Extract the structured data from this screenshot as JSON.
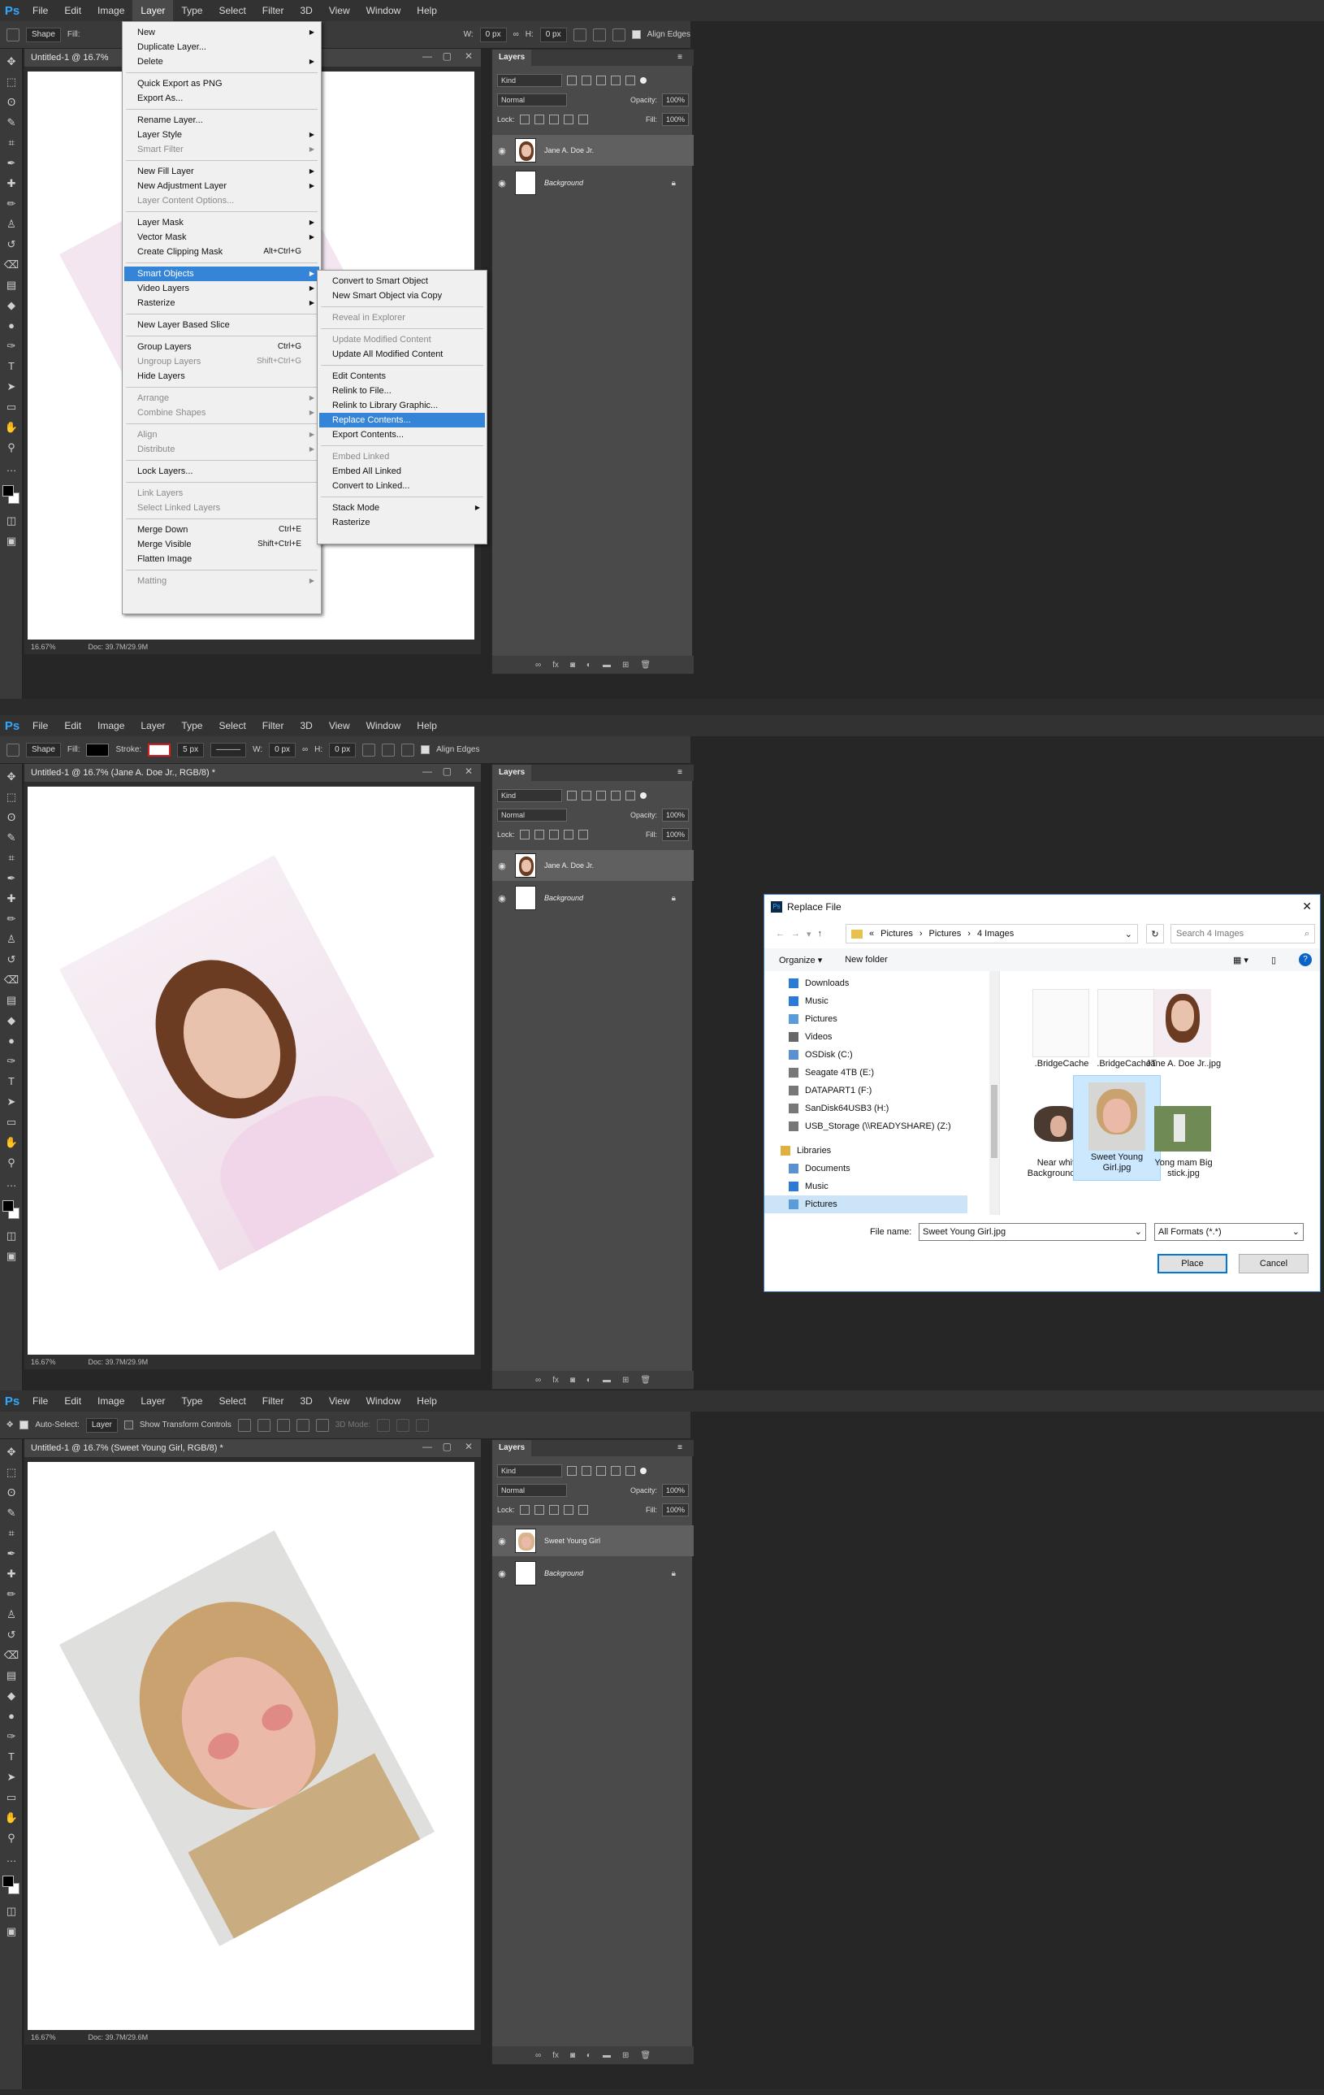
{
  "menubar": [
    "File",
    "Edit",
    "Image",
    "Layer",
    "Type",
    "Select",
    "Filter",
    "3D",
    "View",
    "Window",
    "Help"
  ],
  "shape_options": {
    "mode": "Shape",
    "fill_label": "Fill:",
    "stroke_label": "Stroke:",
    "stroke_size": "5 px",
    "w_label": "W:",
    "w_value": "0 px",
    "h_label": "H:",
    "h_value": "0 px",
    "align_edges": "Align Edges",
    "fill_color": "#000000",
    "stroke_color": "#d22020"
  },
  "move_options": {
    "auto_select": "Auto-Select:",
    "target": "Layer",
    "transform": "Show Transform Controls",
    "mode3d": "3D Mode:"
  },
  "doc": {
    "title1": "Untitled-1 @ 16.7%",
    "title2": "Untitled-1 @ 16.7% (Jane A. Doe Jr., RGB/8) *",
    "title3": "Untitled-1 @ 16.7% (Sweet Young Girl, RGB/8) *",
    "zoom": "16.67%",
    "doc_size1": "Doc: 39.7M/29.9M",
    "doc_size2": "Doc: 39.7M/29.9M",
    "doc_size3": "Doc: 39.7M/29.6M"
  },
  "layers": {
    "tab": "Layers",
    "kind": "Kind",
    "blend": "Normal",
    "opacity_label": "Opacity:",
    "opacity": "100%",
    "lock_label": "Lock:",
    "fill_label": "Fill:",
    "fill": "100%",
    "smart_layer_1": "Jane A. Doe Jr.",
    "smart_layer_2": "Sweet Young Girl",
    "background": "Background",
    "footer": "fx"
  },
  "layer_menu": [
    {
      "label": "New",
      "arrow": true
    },
    {
      "label": "Duplicate Layer..."
    },
    {
      "label": "Delete",
      "arrow": true
    },
    {
      "sep": true
    },
    {
      "label": "Quick Export as PNG"
    },
    {
      "label": "Export As..."
    },
    {
      "sep": true
    },
    {
      "label": "Rename Layer..."
    },
    {
      "label": "Layer Style",
      "arrow": true
    },
    {
      "label": "Smart Filter",
      "arrow": true,
      "disabled": true
    },
    {
      "sep": true
    },
    {
      "label": "New Fill Layer",
      "arrow": true
    },
    {
      "label": "New Adjustment Layer",
      "arrow": true
    },
    {
      "label": "Layer Content Options...",
      "disabled": true
    },
    {
      "sep": true
    },
    {
      "label": "Layer Mask",
      "arrow": true
    },
    {
      "label": "Vector Mask",
      "arrow": true
    },
    {
      "label": "Create Clipping Mask",
      "shortcut": "Alt+Ctrl+G"
    },
    {
      "sep": true
    },
    {
      "label": "Smart Objects",
      "arrow": true,
      "highlight": true
    },
    {
      "label": "Video Layers",
      "arrow": true
    },
    {
      "label": "Rasterize",
      "arrow": true
    },
    {
      "sep": true
    },
    {
      "label": "New Layer Based Slice"
    },
    {
      "sep": true
    },
    {
      "label": "Group Layers",
      "shortcut": "Ctrl+G"
    },
    {
      "label": "Ungroup Layers",
      "shortcut": "Shift+Ctrl+G",
      "disabled": true
    },
    {
      "label": "Hide Layers"
    },
    {
      "sep": true
    },
    {
      "label": "Arrange",
      "arrow": true,
      "disabled": true
    },
    {
      "label": "Combine Shapes",
      "arrow": true,
      "disabled": true
    },
    {
      "sep": true
    },
    {
      "label": "Align",
      "arrow": true,
      "disabled": true
    },
    {
      "label": "Distribute",
      "arrow": true,
      "disabled": true
    },
    {
      "sep": true
    },
    {
      "label": "Lock Layers..."
    },
    {
      "sep": true
    },
    {
      "label": "Link Layers",
      "disabled": true
    },
    {
      "label": "Select Linked Layers",
      "disabled": true
    },
    {
      "sep": true
    },
    {
      "label": "Merge Down",
      "shortcut": "Ctrl+E"
    },
    {
      "label": "Merge Visible",
      "shortcut": "Shift+Ctrl+E"
    },
    {
      "label": "Flatten Image"
    },
    {
      "sep": true
    },
    {
      "label": "Matting",
      "arrow": true,
      "disabled": true
    }
  ],
  "smart_menu": [
    {
      "label": "Convert to Smart Object"
    },
    {
      "label": "New Smart Object via Copy"
    },
    {
      "sep": true
    },
    {
      "label": "Reveal in Explorer",
      "disabled": true
    },
    {
      "sep": true
    },
    {
      "label": "Update Modified Content",
      "disabled": true
    },
    {
      "label": "Update All Modified Content"
    },
    {
      "sep": true
    },
    {
      "label": "Edit Contents"
    },
    {
      "label": "Relink to File..."
    },
    {
      "label": "Relink to Library Graphic..."
    },
    {
      "label": "Replace Contents...",
      "highlight": true
    },
    {
      "label": "Export Contents..."
    },
    {
      "sep": true
    },
    {
      "label": "Embed Linked",
      "disabled": true
    },
    {
      "label": "Embed All Linked"
    },
    {
      "label": "Convert to Linked..."
    },
    {
      "sep": true
    },
    {
      "label": "Stack Mode",
      "arrow": true
    },
    {
      "label": "Rasterize"
    }
  ],
  "dialog": {
    "title": "Replace File",
    "path": [
      "«",
      "Pictures",
      "›",
      "Pictures",
      "›",
      "4 Images"
    ],
    "search": "Search 4 Images",
    "organize": "Organize ▾",
    "new_folder": "New folder",
    "nav": [
      {
        "label": "Downloads",
        "color": "#2b7bd6"
      },
      {
        "label": "Music",
        "color": "#2b7bd6"
      },
      {
        "label": "Pictures",
        "color": "#5a9bd8"
      },
      {
        "label": "Videos",
        "color": "#666666"
      },
      {
        "label": "OSDisk (C:)",
        "color": "#5a8fd0"
      },
      {
        "label": "Seagate 4TB (E:)",
        "color": "#777777"
      },
      {
        "label": "DATAPART1 (F:)",
        "color": "#777777"
      },
      {
        "label": "SanDisk64USB3 (H:)",
        "color": "#777777"
      },
      {
        "label": "USB_Storage (\\\\READYSHARE) (Z:)",
        "color": "#777777"
      },
      {
        "label": "Libraries",
        "color": "#e0b040"
      },
      {
        "label": "Documents",
        "color": "#5a8fd0"
      },
      {
        "label": "Music",
        "color": "#2b7bd6"
      },
      {
        "label": "Pictures",
        "color": "#5a9bd8",
        "selected": true
      }
    ],
    "files": [
      {
        "label": ".BridgeCache",
        "thumb": "blank"
      },
      {
        "label": ".BridgeCacheT",
        "thumb": "blank"
      },
      {
        "label": "Jane A. Doe Jr..jpg",
        "thumb": "jane"
      },
      {
        "label": "Near white Background.jpg",
        "thumb": "wind"
      },
      {
        "label": "Sweet Young Girl.jpg",
        "thumb": "girl",
        "selected": true
      },
      {
        "label": "Yong mam Big stick.jpg",
        "thumb": "stick"
      }
    ],
    "file_name_label": "File name:",
    "file_name": "Sweet Young Girl.jpg",
    "format": "All Formats (*.*)",
    "place": "Place",
    "cancel": "Cancel"
  }
}
